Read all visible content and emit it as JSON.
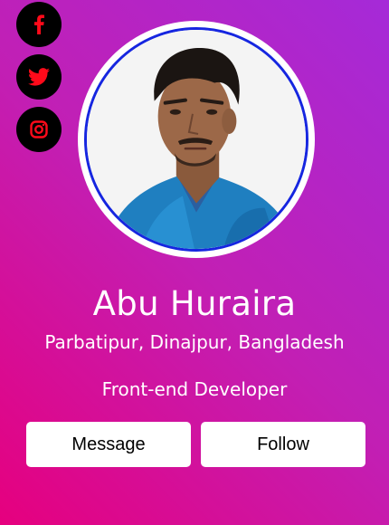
{
  "social": [
    {
      "icon": "facebook-icon",
      "glyph": "f"
    },
    {
      "icon": "twitter-icon"
    },
    {
      "icon": "instagram-icon"
    }
  ],
  "profile": {
    "name": "Abu Huraira",
    "location": "Parbatipur, Dinajpur, Bangladesh",
    "role": "Front-end Developer"
  },
  "actions": {
    "message_label": "Message",
    "follow_label": "Follow"
  },
  "colors": {
    "gradient_start": "#e6007e",
    "gradient_end": "#a52ad8",
    "social_bg": "#000000",
    "social_icon": "#ff0a1a",
    "avatar_border": "#1626e0"
  }
}
